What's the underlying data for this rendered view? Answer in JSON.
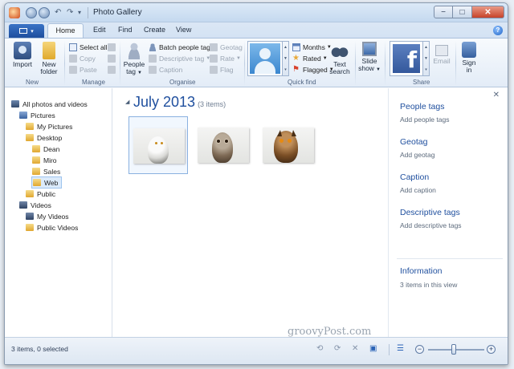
{
  "window": {
    "title": "Photo Gallery",
    "controls": {
      "minimize": "−",
      "maximize": "□",
      "close": "✕"
    }
  },
  "quick_access": {
    "undo": "↶",
    "redo": "↷",
    "customize": "▾"
  },
  "ribbon_tabs": {
    "file_arrow": "▾",
    "tabs": [
      "Home",
      "Edit",
      "Find",
      "Create",
      "View"
    ],
    "active": "Home",
    "help": "?"
  },
  "ribbon": {
    "new_group": {
      "label": "New",
      "import": "Import",
      "new_folder_1": "New",
      "new_folder_2": "folder"
    },
    "manage_group": {
      "label": "Manage",
      "select_all": "Select all",
      "copy": "Copy",
      "paste": "Paste"
    },
    "organise_group": {
      "label": "Organise",
      "people_tag_1": "People",
      "people_tag_2": "tag",
      "batch_people_tag": "Batch people tag",
      "descriptive_tag": "Descriptive tag",
      "caption": "Caption",
      "geotag": "Geotag",
      "rate": "Rate",
      "flag": "Flag"
    },
    "quick_find_group": {
      "label": "Quick find",
      "months": "Months",
      "rated": "Rated",
      "flagged": "Flagged",
      "text_search_1": "Text",
      "text_search_2": "search",
      "slide_show_1": "Slide",
      "slide_show_2": "show"
    },
    "share_group": {
      "label": "Share",
      "facebook_glyph": "f",
      "email": "Email",
      "sign_in_1": "Sign",
      "sign_in_2": "in"
    }
  },
  "navigation": {
    "items": [
      {
        "label": "All photos and videos"
      },
      {
        "label": "Pictures"
      },
      {
        "label": "My Pictures"
      },
      {
        "label": "Desktop"
      },
      {
        "label": "Dean"
      },
      {
        "label": "Miro"
      },
      {
        "label": "Sales"
      },
      {
        "label": "Web",
        "selected": true
      },
      {
        "label": "Public"
      },
      {
        "label": "Videos"
      },
      {
        "label": "My Videos"
      },
      {
        "label": "Public Videos"
      }
    ]
  },
  "content": {
    "collapse_arrow": "◢",
    "group_title": "July 2013",
    "group_count": "(3 items)",
    "thumbnails": [
      {
        "subject": "snowy-owl",
        "selected": true
      },
      {
        "subject": "barred-owl",
        "selected": false
      },
      {
        "subject": "eagle-owl",
        "selected": false
      }
    ]
  },
  "details": {
    "close": "✕",
    "people_tags": "People tags",
    "add_people_tags": "Add people tags",
    "geotag": "Geotag",
    "add_geotag": "Add geotag",
    "caption": "Caption",
    "add_caption": "Add caption",
    "descriptive_tags": "Descriptive tags",
    "add_descriptive_tags": "Add descriptive tags",
    "information": "Information",
    "items_in_view": "3 items in this view"
  },
  "watermark": "groovyPost.com",
  "status": {
    "text": "3 items, 0 selected",
    "zoom_minus": "−",
    "zoom_plus": "+",
    "zoom_fraction": 0.45
  }
}
